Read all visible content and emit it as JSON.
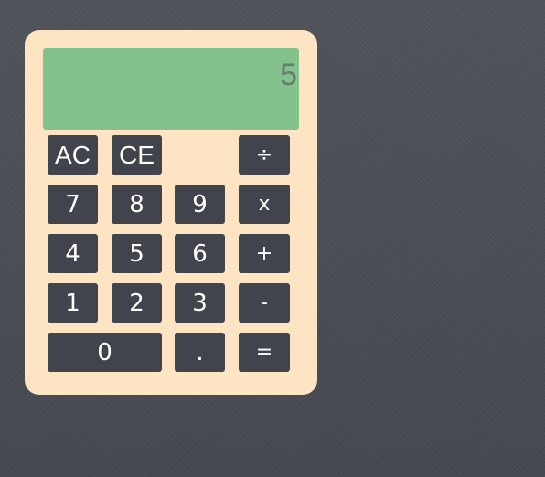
{
  "calculator": {
    "display": {
      "value": "5"
    },
    "keys": {
      "ac": "AC",
      "ce": "CE",
      "divide": "÷",
      "seven": "7",
      "eight": "8",
      "nine": "9",
      "multiply": "x",
      "four": "4",
      "five": "5",
      "six": "6",
      "add": "+",
      "one": "1",
      "two": "2",
      "three": "3",
      "subtract": "-",
      "zero": "0",
      "decimal": ".",
      "equals": "="
    }
  },
  "colors": {
    "background": "#4a4d54",
    "body": "#fde4c3",
    "display": "#83c28c",
    "display_text": "#6c7a70",
    "key": "#41444c",
    "key_text": "#ffffff"
  }
}
